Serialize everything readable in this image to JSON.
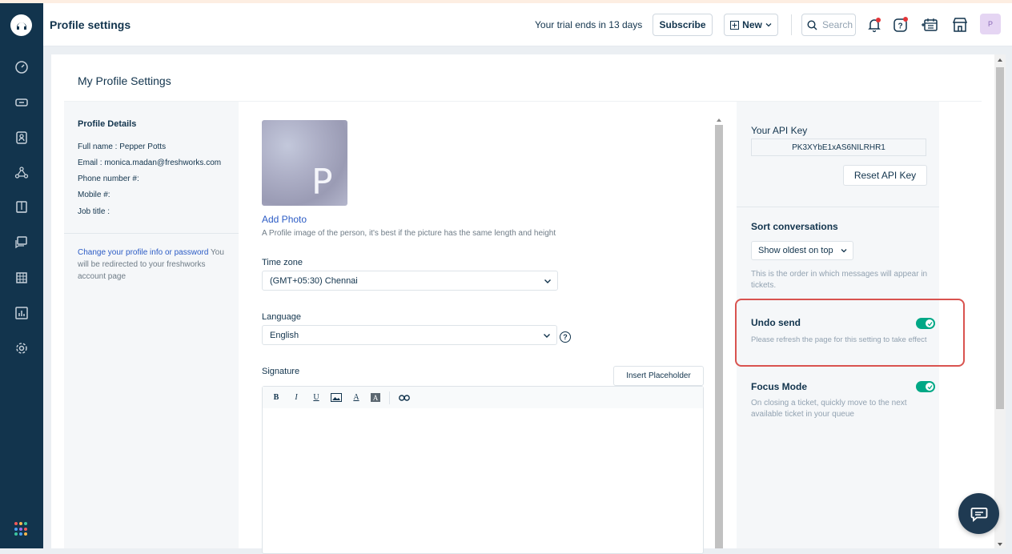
{
  "header": {
    "title": "Profile settings",
    "trial_text": "Your trial ends in 13 days",
    "subscribe_label": "Subscribe",
    "new_label": "New",
    "search_placeholder": "Search",
    "avatar_initial": "P"
  },
  "page": {
    "heading": "My Profile Settings"
  },
  "profile": {
    "section_title": "Profile Details",
    "full_name_label": "Full name : ",
    "full_name": "Pepper Potts",
    "email_label": "Email : ",
    "email": "monica.madan@freshworks.com",
    "phone_label": "Phone number #:",
    "mobile_label": "Mobile #:",
    "job_title_label": "Job title :",
    "change_link": "Change your profile info or password",
    "change_note": " You will be redirected to your freshworks account page"
  },
  "photo": {
    "initial": "P",
    "add_label": "Add Photo",
    "hint": "A Profile image of the person, it's best if the picture has the same length and height"
  },
  "timezone": {
    "label": "Time zone",
    "value": "(GMT+05:30) Chennai"
  },
  "language": {
    "label": "Language",
    "value": "English",
    "help_icon": "?"
  },
  "signature": {
    "label": "Signature",
    "insert_label": "Insert Placeholder",
    "toolbar": {
      "bold": "B",
      "italic": "I",
      "underline": "U",
      "font_color": "A",
      "bg_color": "A"
    }
  },
  "api": {
    "title": "Your API Key",
    "key": "PK3XYbE1xAS6NILRHR1",
    "reset_label": "Reset API Key"
  },
  "sort": {
    "title": "Sort conversations",
    "value": "Show oldest on top",
    "note": "This is the order in which messages will appear in tickets."
  },
  "undo_send": {
    "title": "Undo send",
    "note": "Please refresh the page for this setting to take effect",
    "enabled": true
  },
  "focus_mode": {
    "title": "Focus Mode",
    "note": "On closing a ticket, quickly move to the next available ticket in your queue",
    "enabled": true
  },
  "colors": {
    "rail": "#12344d",
    "accent_link": "#2c5cc5",
    "toggle_on": "#00a886",
    "highlight": "#d9534f"
  }
}
